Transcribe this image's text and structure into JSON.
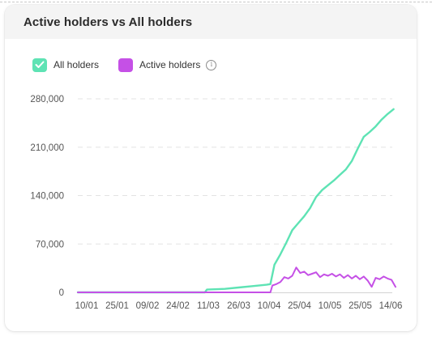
{
  "card": {
    "title": "Active holders vs All holders"
  },
  "legend": [
    {
      "label": "All holders",
      "color": "#5ee3b4",
      "icon": "checkbox-checked-icon"
    },
    {
      "label": "Active holders",
      "color": "#c550e6",
      "icon": "info-icon"
    }
  ],
  "chart_data": {
    "type": "line",
    "title": "Active holders vs All holders",
    "xlabel": "",
    "ylabel": "",
    "x_ticks": [
      "10/01",
      "25/01",
      "09/02",
      "24/02",
      "11/03",
      "26/03",
      "10/04",
      "25/04",
      "10/05",
      "25/05",
      "14/06"
    ],
    "y_ticks": [
      "0",
      "70,000",
      "140,000",
      "210,000",
      "280,000"
    ],
    "ylim": [
      0,
      280000
    ],
    "grid": "horizontal dashed",
    "legend_position": "top-left",
    "x_domain": [
      "2023-01-10",
      "2023-06-19"
    ],
    "series": [
      {
        "name": "All holders",
        "color": "#5ee3b4",
        "points": [
          [
            "2023-01-10",
            0
          ],
          [
            "2023-03-15",
            0
          ],
          [
            "2023-03-16",
            4000
          ],
          [
            "2023-03-25",
            5000
          ],
          [
            "2023-04-01",
            7000
          ],
          [
            "2023-04-08",
            9000
          ],
          [
            "2023-04-15",
            11000
          ],
          [
            "2023-04-17",
            12000
          ],
          [
            "2023-04-19",
            40000
          ],
          [
            "2023-04-22",
            55000
          ],
          [
            "2023-04-25",
            72000
          ],
          [
            "2023-04-28",
            90000
          ],
          [
            "2023-05-01",
            100000
          ],
          [
            "2023-05-04",
            110000
          ],
          [
            "2023-05-07",
            122000
          ],
          [
            "2023-05-10",
            138000
          ],
          [
            "2023-05-13",
            148000
          ],
          [
            "2023-05-16",
            155000
          ],
          [
            "2023-05-19",
            162000
          ],
          [
            "2023-05-22",
            170000
          ],
          [
            "2023-05-25",
            178000
          ],
          [
            "2023-05-28",
            190000
          ],
          [
            "2023-05-31",
            208000
          ],
          [
            "2023-06-03",
            225000
          ],
          [
            "2023-06-06",
            232000
          ],
          [
            "2023-06-09",
            240000
          ],
          [
            "2023-06-12",
            250000
          ],
          [
            "2023-06-15",
            258000
          ],
          [
            "2023-06-18",
            265000
          ]
        ]
      },
      {
        "name": "Active holders",
        "color": "#c550e6",
        "points": [
          [
            "2023-01-10",
            0
          ],
          [
            "2023-04-17",
            0
          ],
          [
            "2023-04-18",
            10000
          ],
          [
            "2023-04-20",
            12000
          ],
          [
            "2023-04-22",
            15000
          ],
          [
            "2023-04-24",
            22000
          ],
          [
            "2023-04-26",
            20000
          ],
          [
            "2023-04-28",
            24000
          ],
          [
            "2023-04-30",
            36000
          ],
          [
            "2023-05-02",
            28000
          ],
          [
            "2023-05-04",
            30000
          ],
          [
            "2023-05-06",
            25000
          ],
          [
            "2023-05-08",
            27000
          ],
          [
            "2023-05-10",
            29000
          ],
          [
            "2023-05-12",
            22000
          ],
          [
            "2023-05-14",
            26000
          ],
          [
            "2023-05-16",
            24000
          ],
          [
            "2023-05-18",
            27000
          ],
          [
            "2023-05-20",
            23000
          ],
          [
            "2023-05-22",
            26000
          ],
          [
            "2023-05-24",
            21000
          ],
          [
            "2023-05-26",
            25000
          ],
          [
            "2023-05-28",
            20000
          ],
          [
            "2023-05-30",
            24000
          ],
          [
            "2023-06-01",
            19000
          ],
          [
            "2023-06-03",
            23000
          ],
          [
            "2023-06-05",
            17000
          ],
          [
            "2023-06-07",
            8000
          ],
          [
            "2023-06-09",
            21000
          ],
          [
            "2023-06-11",
            19000
          ],
          [
            "2023-06-13",
            23000
          ],
          [
            "2023-06-15",
            20000
          ],
          [
            "2023-06-17",
            18000
          ],
          [
            "2023-06-19",
            8000
          ]
        ]
      }
    ]
  }
}
